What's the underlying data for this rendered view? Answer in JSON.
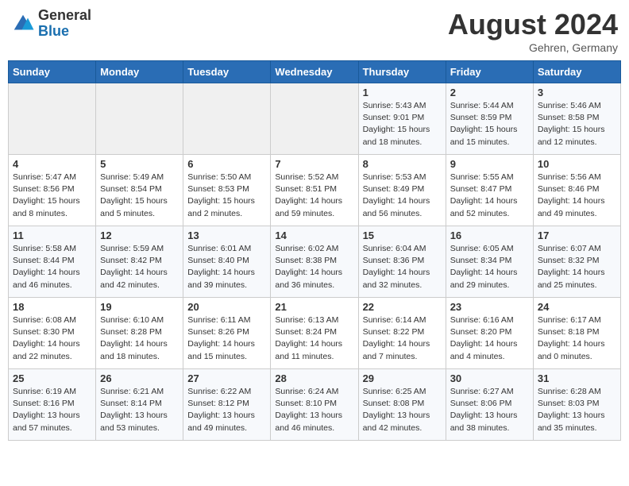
{
  "header": {
    "logo_general": "General",
    "logo_blue": "Blue",
    "month_title": "August 2024",
    "location": "Gehren, Germany"
  },
  "days_of_week": [
    "Sunday",
    "Monday",
    "Tuesday",
    "Wednesday",
    "Thursday",
    "Friday",
    "Saturday"
  ],
  "weeks": [
    [
      {
        "day": "",
        "empty": true
      },
      {
        "day": "",
        "empty": true
      },
      {
        "day": "",
        "empty": true
      },
      {
        "day": "",
        "empty": true
      },
      {
        "day": "1",
        "info": "Sunrise: 5:43 AM\nSunset: 9:01 PM\nDaylight: 15 hours\nand 18 minutes."
      },
      {
        "day": "2",
        "info": "Sunrise: 5:44 AM\nSunset: 8:59 PM\nDaylight: 15 hours\nand 15 minutes."
      },
      {
        "day": "3",
        "info": "Sunrise: 5:46 AM\nSunset: 8:58 PM\nDaylight: 15 hours\nand 12 minutes."
      }
    ],
    [
      {
        "day": "4",
        "info": "Sunrise: 5:47 AM\nSunset: 8:56 PM\nDaylight: 15 hours\nand 8 minutes."
      },
      {
        "day": "5",
        "info": "Sunrise: 5:49 AM\nSunset: 8:54 PM\nDaylight: 15 hours\nand 5 minutes."
      },
      {
        "day": "6",
        "info": "Sunrise: 5:50 AM\nSunset: 8:53 PM\nDaylight: 15 hours\nand 2 minutes."
      },
      {
        "day": "7",
        "info": "Sunrise: 5:52 AM\nSunset: 8:51 PM\nDaylight: 14 hours\nand 59 minutes."
      },
      {
        "day": "8",
        "info": "Sunrise: 5:53 AM\nSunset: 8:49 PM\nDaylight: 14 hours\nand 56 minutes."
      },
      {
        "day": "9",
        "info": "Sunrise: 5:55 AM\nSunset: 8:47 PM\nDaylight: 14 hours\nand 52 minutes."
      },
      {
        "day": "10",
        "info": "Sunrise: 5:56 AM\nSunset: 8:46 PM\nDaylight: 14 hours\nand 49 minutes."
      }
    ],
    [
      {
        "day": "11",
        "info": "Sunrise: 5:58 AM\nSunset: 8:44 PM\nDaylight: 14 hours\nand 46 minutes."
      },
      {
        "day": "12",
        "info": "Sunrise: 5:59 AM\nSunset: 8:42 PM\nDaylight: 14 hours\nand 42 minutes."
      },
      {
        "day": "13",
        "info": "Sunrise: 6:01 AM\nSunset: 8:40 PM\nDaylight: 14 hours\nand 39 minutes."
      },
      {
        "day": "14",
        "info": "Sunrise: 6:02 AM\nSunset: 8:38 PM\nDaylight: 14 hours\nand 36 minutes."
      },
      {
        "day": "15",
        "info": "Sunrise: 6:04 AM\nSunset: 8:36 PM\nDaylight: 14 hours\nand 32 minutes."
      },
      {
        "day": "16",
        "info": "Sunrise: 6:05 AM\nSunset: 8:34 PM\nDaylight: 14 hours\nand 29 minutes."
      },
      {
        "day": "17",
        "info": "Sunrise: 6:07 AM\nSunset: 8:32 PM\nDaylight: 14 hours\nand 25 minutes."
      }
    ],
    [
      {
        "day": "18",
        "info": "Sunrise: 6:08 AM\nSunset: 8:30 PM\nDaylight: 14 hours\nand 22 minutes."
      },
      {
        "day": "19",
        "info": "Sunrise: 6:10 AM\nSunset: 8:28 PM\nDaylight: 14 hours\nand 18 minutes."
      },
      {
        "day": "20",
        "info": "Sunrise: 6:11 AM\nSunset: 8:26 PM\nDaylight: 14 hours\nand 15 minutes."
      },
      {
        "day": "21",
        "info": "Sunrise: 6:13 AM\nSunset: 8:24 PM\nDaylight: 14 hours\nand 11 minutes."
      },
      {
        "day": "22",
        "info": "Sunrise: 6:14 AM\nSunset: 8:22 PM\nDaylight: 14 hours\nand 7 minutes."
      },
      {
        "day": "23",
        "info": "Sunrise: 6:16 AM\nSunset: 8:20 PM\nDaylight: 14 hours\nand 4 minutes."
      },
      {
        "day": "24",
        "info": "Sunrise: 6:17 AM\nSunset: 8:18 PM\nDaylight: 14 hours\nand 0 minutes."
      }
    ],
    [
      {
        "day": "25",
        "info": "Sunrise: 6:19 AM\nSunset: 8:16 PM\nDaylight: 13 hours\nand 57 minutes."
      },
      {
        "day": "26",
        "info": "Sunrise: 6:21 AM\nSunset: 8:14 PM\nDaylight: 13 hours\nand 53 minutes."
      },
      {
        "day": "27",
        "info": "Sunrise: 6:22 AM\nSunset: 8:12 PM\nDaylight: 13 hours\nand 49 minutes."
      },
      {
        "day": "28",
        "info": "Sunrise: 6:24 AM\nSunset: 8:10 PM\nDaylight: 13 hours\nand 46 minutes."
      },
      {
        "day": "29",
        "info": "Sunrise: 6:25 AM\nSunset: 8:08 PM\nDaylight: 13 hours\nand 42 minutes."
      },
      {
        "day": "30",
        "info": "Sunrise: 6:27 AM\nSunset: 8:06 PM\nDaylight: 13 hours\nand 38 minutes."
      },
      {
        "day": "31",
        "info": "Sunrise: 6:28 AM\nSunset: 8:03 PM\nDaylight: 13 hours\nand 35 minutes."
      }
    ]
  ]
}
